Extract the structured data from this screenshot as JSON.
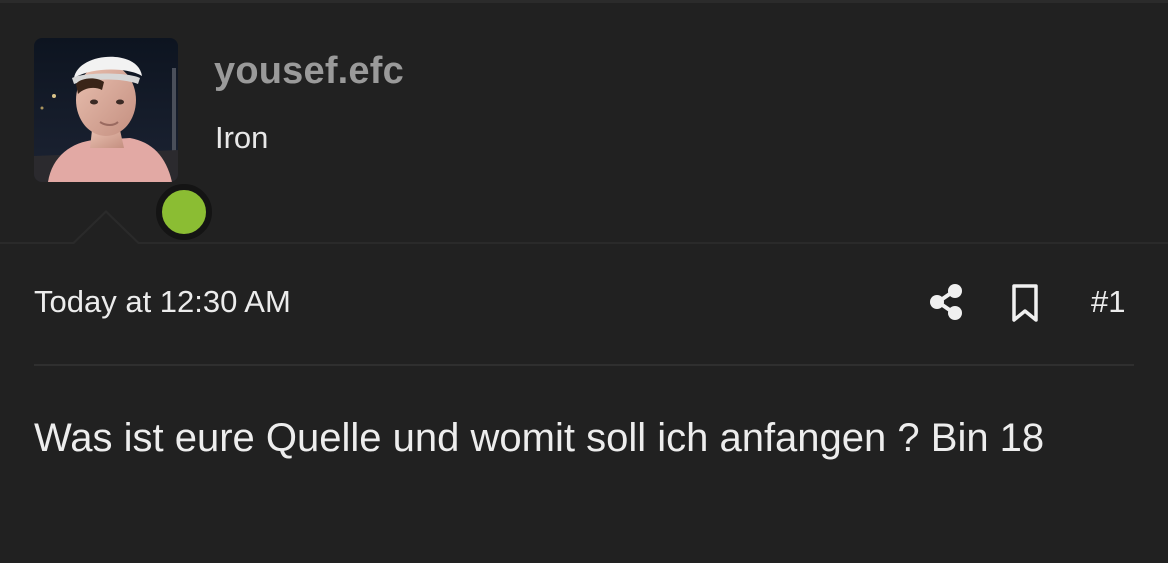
{
  "user": {
    "name": "yousef.efc",
    "title": "Iron",
    "online": true,
    "avatar_alt": "user avatar",
    "online_color": "#8bbd33"
  },
  "post": {
    "timestamp": "Today at 12:30 AM",
    "number": "#1",
    "message": "Was ist eure Quelle und womit soll ich anfangen ? Bin 18"
  },
  "icons": {
    "share": "share-icon",
    "bookmark": "bookmark-icon"
  }
}
